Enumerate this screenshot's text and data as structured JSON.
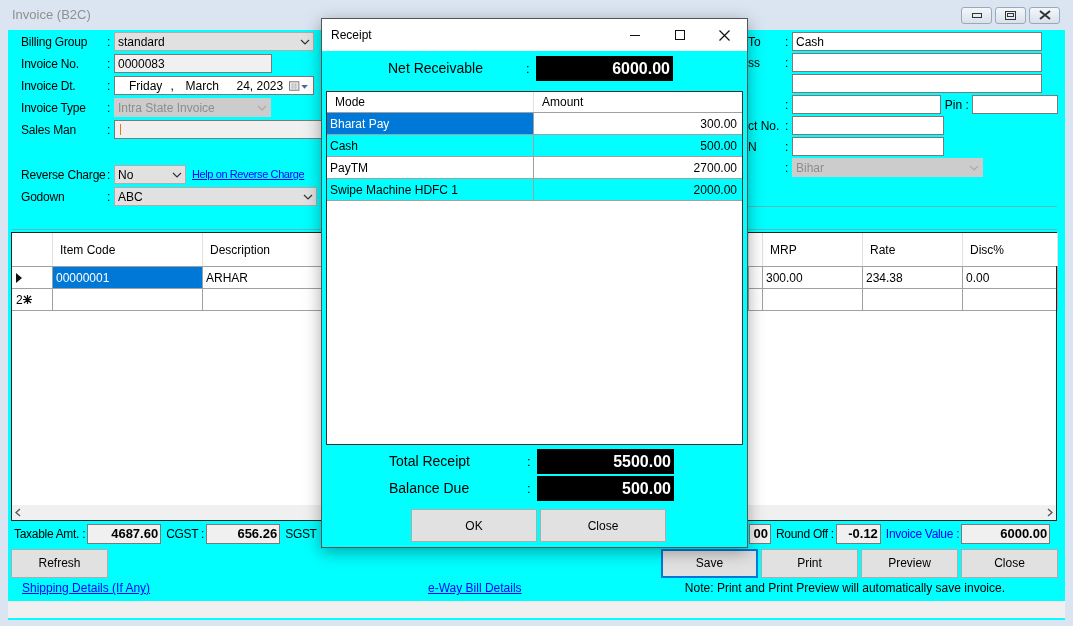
{
  "window": {
    "title": "Invoice (B2C)"
  },
  "billing_fields": [
    {
      "label": "Billing Group",
      "colon": ":",
      "kind": "combo",
      "value": "standard",
      "disabled": false
    },
    {
      "label": "Invoice No.",
      "colon": ":",
      "kind": "text",
      "value": "0000083"
    },
    {
      "label": "Invoice Dt.",
      "colon": ":",
      "kind": "date",
      "parts": [
        "Friday",
        ",",
        "March",
        "24, 2023"
      ]
    },
    {
      "label": "Invoice Type",
      "colon": ":",
      "kind": "combo",
      "value": "Intra State Invoice",
      "disabled": true
    },
    {
      "label": "Sales Man",
      "colon": ":",
      "kind": "text",
      "caret": true
    }
  ],
  "reverse_charge": {
    "label": "Reverse Charge",
    "colon": ":",
    "value": "No",
    "link": "Help on Reverse Charge"
  },
  "godown": {
    "label": "Godown",
    "colon": ":",
    "value": "ABC"
  },
  "party_fields": [
    {
      "label": "To",
      "colon": ":",
      "kind": "text",
      "value": "Cash"
    },
    {
      "label": "ss",
      "colon": ":",
      "kind": "text"
    },
    {
      "kind": "text"
    },
    {
      "colon": ":",
      "kind": "text",
      "pin_label": "Pin :"
    },
    {
      "label": "ct No.",
      "colon": ":",
      "kind": "text"
    },
    {
      "label": "N",
      "colon": ":",
      "kind": "text"
    },
    {
      "colon": ":",
      "kind": "combo",
      "value": "Bihar",
      "disabled": true
    }
  ],
  "grid": {
    "columns": [
      {},
      {
        "label": "Item Code"
      },
      {
        "label": "Description"
      },
      {},
      {
        "label": "MRP"
      },
      {
        "label": "Rate"
      },
      {
        "label": "Disc%"
      }
    ],
    "rows": [
      {
        "cells": [
          {
            "kind": "current",
            "selected": false
          },
          {
            "text": "00000001",
            "selected": true
          },
          {
            "text": "ARHAR",
            "selected": false
          },
          {
            "selected": false
          },
          {
            "text": "300.00",
            "selected": false
          },
          {
            "text": "234.38",
            "selected": false
          },
          {
            "text": "0.00",
            "selected": false
          }
        ]
      },
      {
        "cells": [
          {
            "kind": "new",
            "text": "2",
            "selected": false
          },
          {
            "selected": false
          },
          {
            "selected": false
          },
          {
            "selected": false
          },
          {
            "selected": false
          },
          {
            "selected": false
          },
          {
            "selected": false
          }
        ]
      }
    ]
  },
  "totals_left": [
    {
      "label": "Taxable Amt. :",
      "value": "4687.60",
      "highlighted": false
    },
    {
      "label": "CGST :",
      "value": "656.26",
      "highlighted": false
    },
    {
      "label": "SGST",
      "highlighted": false
    }
  ],
  "totals_right": [
    {
      "value": "00"
    },
    {
      "label": "Round Off :",
      "value": "-0.12",
      "highlighted": false
    },
    {
      "label": "Invoice Value :",
      "value": "6000.00",
      "highlighted": true
    }
  ],
  "buttons_left": [
    {
      "label": "Refresh",
      "focused": false
    }
  ],
  "buttons_right": [
    {
      "label": "Save",
      "focused": true
    },
    {
      "label": "Print",
      "focused": false
    },
    {
      "label": "Preview",
      "focused": false
    },
    {
      "label": "Close",
      "focused": false
    }
  ],
  "links": {
    "shipping": "Shipping Details (If Any)",
    "eway": "e-Way Bill Details",
    "note": "Note: Print and Print Preview will automatically save invoice."
  },
  "dialog": {
    "title": "Receipt",
    "net_receivable": {
      "label": "Net Receivable",
      "colon": ":",
      "value": "6000.00"
    },
    "columns": [
      "Mode",
      "Amount"
    ],
    "rows": [
      {
        "mode": "Bharat Pay",
        "amount": "300.00",
        "selected": true
      },
      {
        "mode": "Cash",
        "amount": "500.00",
        "selected": false
      },
      {
        "mode": "PayTM",
        "amount": "2700.00",
        "selected": false
      },
      {
        "mode": "Swipe Machine HDFC 1",
        "amount": "2000.00",
        "selected": false
      }
    ],
    "totals": [
      {
        "label": "Total Receipt",
        "colon": ":",
        "value": "5500.00"
      },
      {
        "label": "Balance Due",
        "colon": ":",
        "value": "500.00"
      }
    ],
    "buttons": [
      "OK",
      "Close"
    ]
  }
}
